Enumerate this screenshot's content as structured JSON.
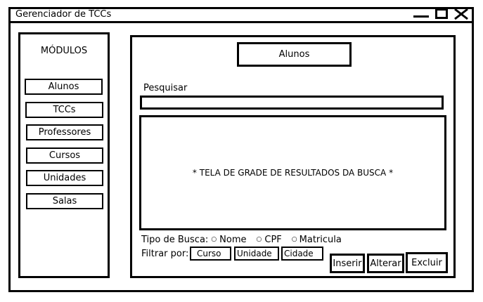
{
  "window": {
    "title": "Gerenciador de TCCs",
    "controls": {
      "minimize": "minimize-icon",
      "maximize": "maximize-icon",
      "close": "close-icon"
    }
  },
  "sidebar": {
    "heading": "MÓDULOS",
    "items": [
      {
        "label": "Alunos"
      },
      {
        "label": "TCCs"
      },
      {
        "label": "Professores"
      },
      {
        "label": "Cursos"
      },
      {
        "label": "Unidades"
      },
      {
        "label": "Salas"
      }
    ]
  },
  "main": {
    "title": "Alunos",
    "search": {
      "label": "Pesquisar",
      "value": ""
    },
    "results_text": "* TELA DE GRADE DE RESULTADOS DA BUSCA *",
    "search_type": {
      "label": "Tipo de Busca:",
      "options": [
        {
          "label": "Nome"
        },
        {
          "label": "CPF"
        },
        {
          "label": "Matricula"
        }
      ]
    },
    "filter": {
      "label": "Filtrar por:",
      "fields": [
        {
          "value": "Curso"
        },
        {
          "value": "Unidade"
        },
        {
          "value": "Cidade"
        }
      ]
    },
    "actions": {
      "insert": "Inserir",
      "edit": "Alterar",
      "delete": "Excluir"
    }
  }
}
